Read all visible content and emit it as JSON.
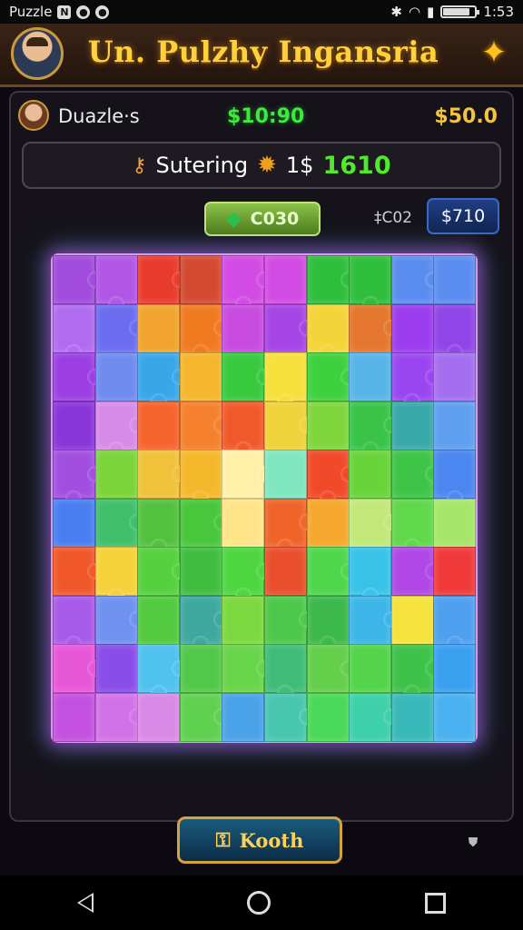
{
  "status_bar": {
    "app_label": "Puzzle",
    "time": "1:53",
    "icons": [
      "notification-icon",
      "record-icon",
      "record-icon",
      "bluetooth-icon",
      "wifi-icon",
      "signal-icon",
      "battery-icon"
    ]
  },
  "header": {
    "title": "Un. Pulzhy Ingansria",
    "star_icon": "star-icon"
  },
  "info_bar": {
    "player_name": "Duazle·s",
    "money_green": "$10:90",
    "money_gold": "$50.0"
  },
  "score_bar": {
    "label": "Sutering",
    "separator": "1$",
    "value": "1610"
  },
  "actions": {
    "coin_label": "C030",
    "cost_label": "‡C02",
    "price_label": "$710"
  },
  "board": {
    "cols": 10,
    "rows": 10,
    "colors": [
      [
        "#a04bdc",
        "#b055e6",
        "#e93b2d",
        "#d44a30",
        "#d24be4",
        "#d24be4",
        "#2fbe3c",
        "#2fbe3c",
        "#5b8df0",
        "#5b8df0"
      ],
      [
        "#b06bf0",
        "#6a6df0",
        "#f0a42d",
        "#f07a20",
        "#c84be0",
        "#a645e6",
        "#f5d33a",
        "#e4772d",
        "#9b3cee",
        "#8f45e8"
      ],
      [
        "#9b3fe2",
        "#6f8bf0",
        "#39a6e8",
        "#f5b52d",
        "#39c93f",
        "#f7e03c",
        "#3ed13e",
        "#58b4e8",
        "#9a46f0",
        "#a46ef0"
      ],
      [
        "#8a35d8",
        "#d78be8",
        "#f5642d",
        "#f5802d",
        "#f05a2a",
        "#f0d23a",
        "#7ed63c",
        "#39c448",
        "#39a8a8",
        "#5f9ff0"
      ],
      [
        "#a24fe0",
        "#7ad43a",
        "#f0c23a",
        "#f5b82d",
        "#fff0a8",
        "#7fe6c0",
        "#f04a2a",
        "#68d43a",
        "#3ec548",
        "#4a87f0"
      ],
      [
        "#4a7ef0",
        "#3fbf6a",
        "#52c23e",
        "#48c63c",
        "#ffe58a",
        "#f0642a",
        "#f5a82d",
        "#c2e87a",
        "#5fd84a",
        "#a6e66a"
      ],
      [
        "#f0582a",
        "#f5d23a",
        "#56d03e",
        "#3fbd3f",
        "#4ed640",
        "#e94f2d",
        "#4fd64c",
        "#39c2e8",
        "#b047e6",
        "#f03a3a"
      ],
      [
        "#a85ae8",
        "#6f92f0",
        "#52c93e",
        "#3ea8a0",
        "#7bd83e",
        "#4ec84a",
        "#3db84a",
        "#3eb5e8",
        "#f5e23c",
        "#4f9ff0"
      ],
      [
        "#e657d8",
        "#8a4ee8",
        "#4fc2f0",
        "#52c84a",
        "#68d44a",
        "#3fbd78",
        "#63cf4a",
        "#54d44a",
        "#3ec24a",
        "#3aa0f0"
      ],
      [
        "#c450e0",
        "#d272e8",
        "#d98ae6",
        "#5fd050",
        "#4aa2e8",
        "#48c6b0",
        "#4ad858",
        "#3ed0a8",
        "#38b8b8",
        "#4ab2f0"
      ]
    ],
    "highlight_color": "#c85af0"
  },
  "bottom": {
    "button_label": "Kooth"
  }
}
